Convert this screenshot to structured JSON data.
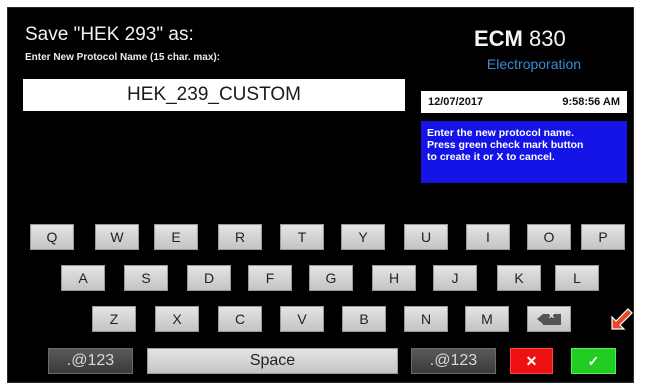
{
  "header": {
    "title": "Save \"HEK 293\" as:",
    "subtitle": "Enter New Protocol Name (15 char. max):"
  },
  "name_input": {
    "value": "HEK_239_CUSTOM"
  },
  "brand": {
    "name": "ECM",
    "model": "830",
    "subtitle": "Electroporation"
  },
  "status": {
    "date": "12/07/2017",
    "time": "9:58:56 AM"
  },
  "hint": {
    "lines": [
      "Enter the new protocol name.",
      "Press green check mark button",
      "to create it or X to cancel."
    ]
  },
  "keyboard": {
    "row1": [
      "Q",
      "W",
      "E",
      "R",
      "T",
      "Y",
      "U",
      "I",
      "O",
      "P"
    ],
    "row2": [
      "A",
      "S",
      "D",
      "F",
      "G",
      "H",
      "J",
      "K",
      "L"
    ],
    "row3": [
      "Z",
      "X",
      "C",
      "V",
      "B",
      "N",
      "M"
    ],
    "backspace_icon": "backspace-icon",
    "symbols_left": ".@123",
    "space": "Space",
    "symbols_right": ".@123",
    "cancel": "✕",
    "confirm": "✓"
  },
  "colors": {
    "screen_bg": "#000000",
    "brand_accent": "#3a8bd6",
    "hint_bg": "#1414e6",
    "cancel_red": "#ee1111",
    "confirm_green": "#22cc22",
    "pointer_arrow": "#e8472b"
  },
  "annotation": {
    "icon": "pointer-arrow-icon"
  }
}
